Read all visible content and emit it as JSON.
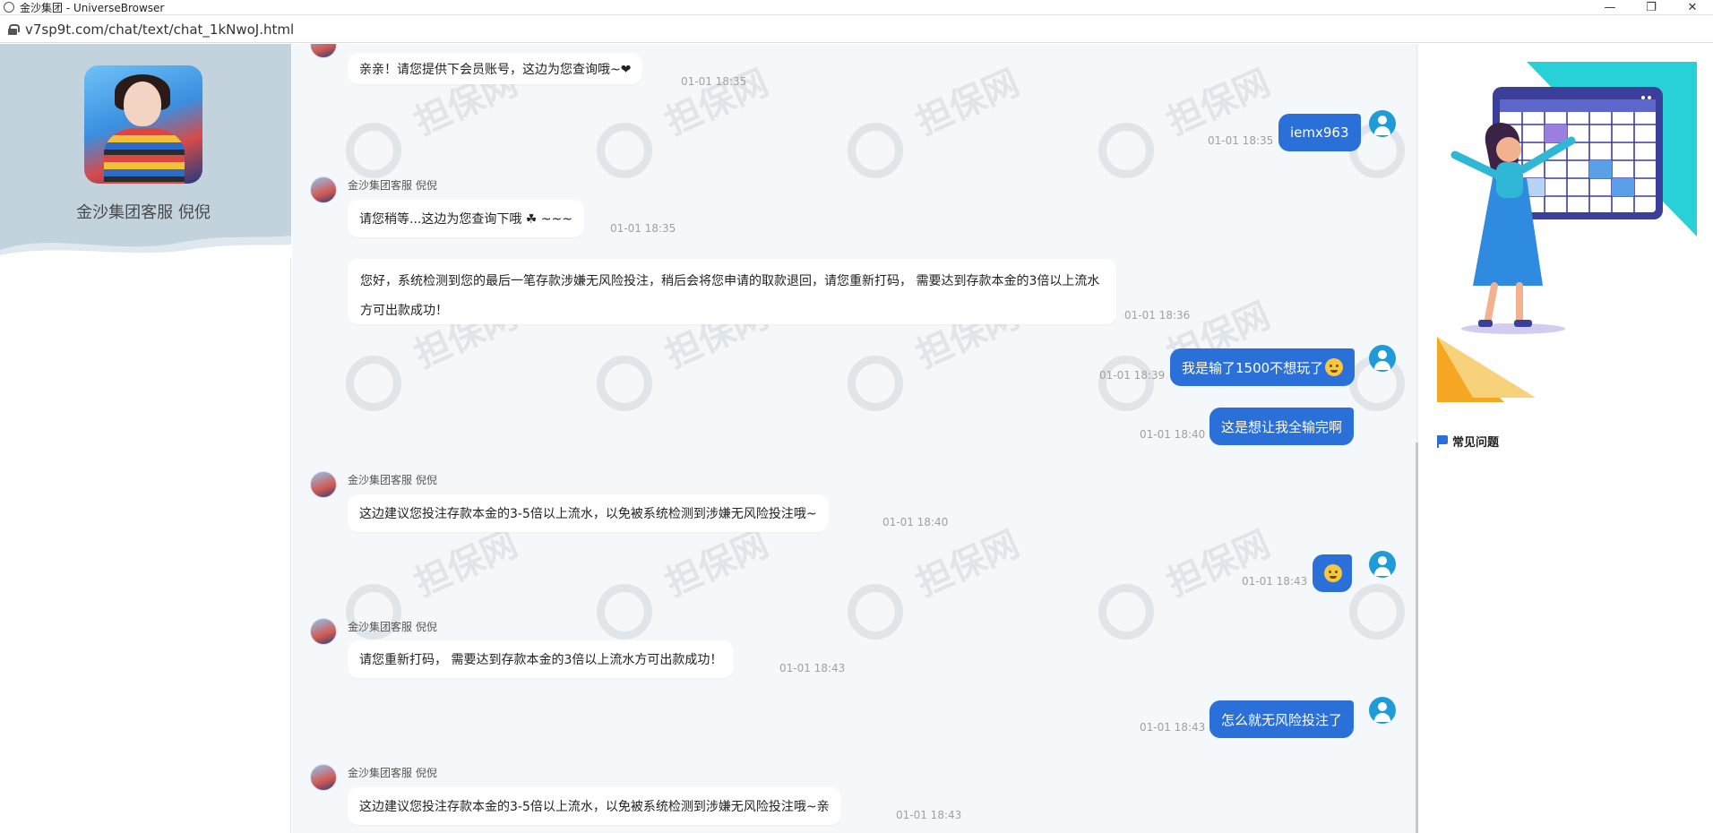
{
  "window": {
    "title": "金沙集团 - UniverseBrowser",
    "minimize": "—",
    "restore": "❐",
    "close": "✕"
  },
  "address": {
    "url": "v7sp9t.com/chat/text/chat_1kNwoJ.html"
  },
  "left": {
    "agent_name": "金沙集团客服 倪倪"
  },
  "watermark": {
    "text": "担保网"
  },
  "messages": [
    {
      "side": "in",
      "text": "亲亲！请您提供下会员账号，这边为您查询哦~❤",
      "time": "01-01 18:35"
    },
    {
      "side": "out",
      "text": "iemx963",
      "time": "01-01 18:35"
    },
    {
      "side": "in",
      "sender": "金沙集团客服 倪倪",
      "text": "请您稍等...这边为您查询下哦 ☘ ~~~",
      "time": "01-01 18:35"
    },
    {
      "side": "in",
      "text": "您好，系统检测到您的最后一笔存款涉嫌无风险投注，稍后会将您申请的取款退回，请您重新打码， 需要达到存款本金的3倍以上流水方可出款成功！",
      "time": "01-01 18:36"
    },
    {
      "side": "out",
      "text": "我是输了1500不想玩了",
      "time": "01-01 18:39"
    },
    {
      "side": "out",
      "text": "这是想让我全输完啊",
      "time": "01-01 18:40"
    },
    {
      "side": "in",
      "sender": "金沙集团客服 倪倪",
      "text": "这边建议您投注存款本金的3-5倍以上流水，以免被系统检测到涉嫌无风险投注哦~",
      "time": "01-01 18:40"
    },
    {
      "side": "out",
      "text": "",
      "time": "01-01 18:43"
    },
    {
      "side": "in",
      "sender": "金沙集团客服 倪倪",
      "text": "请您重新打码， 需要达到存款本金的3倍以上流水方可出款成功！",
      "time": "01-01 18:43"
    },
    {
      "side": "out",
      "text": "怎么就无风险投注了",
      "time": "01-01 18:43"
    },
    {
      "side": "in",
      "sender": "金沙集团客服 倪倪",
      "text": "这边建议您投注存款本金的3-5倍以上流水，以免被系统检测到涉嫌无风险投注哦~亲",
      "time": "01-01 18:43"
    }
  ],
  "right": {
    "faq_label": "常见问题"
  },
  "colors": {
    "accent": "#2b6fd9",
    "user_avatar": "#1f9bd8",
    "chat_bg": "#f5f8fb",
    "header_bg": "#c3d3de"
  }
}
